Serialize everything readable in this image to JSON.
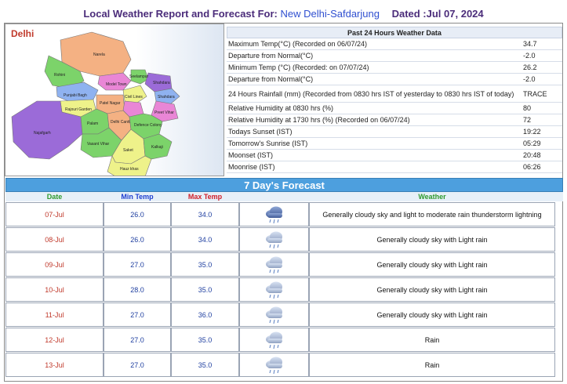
{
  "header": {
    "title_prefix": "Local Weather Report and Forecast For:",
    "location": "New Delhi-Safdarjung",
    "dated": "Dated :Jul 07, 2024"
  },
  "map": {
    "label": "Delhi",
    "districts": [
      "Narela",
      "Rohini",
      "Model Town",
      "Seelampur",
      "Shahdara",
      "Shahdara",
      "Punjabi Bagh",
      "Civil Lines",
      "Rajouri Garden",
      "Patel Nagar",
      "Preet Vihar",
      "Najafgarh",
      "Palam",
      "Vasant Vihar",
      "Delhi Cantt",
      "Defence Colony",
      "Saket",
      "Kalkaji",
      "Hauz khas"
    ],
    "colors": {
      "orange": "#f4b183",
      "green": "#7cd36a",
      "purple": "#9b6bd8",
      "yellow": "#eef28a",
      "pink": "#e986d6",
      "blue": "#8fb2f0"
    }
  },
  "past24": {
    "heading": "Past 24 Hours Weather Data",
    "rows": [
      {
        "label": "Maximum Temp(°C) (Recorded on 06/07/24)",
        "value": "34.7"
      },
      {
        "label": "Departure from Normal(°C)",
        "value": "-2.0"
      },
      {
        "label": "Minimum Temp (°C) (Recorded: on 07/07/24)",
        "value": "26.2"
      },
      {
        "label": "Departure from Normal(°C)",
        "value": "-2.0"
      },
      {
        "label": "24 Hours Rainfall (mm) (Recorded from 0830 hrs IST of yesterday to 0830 hrs IST of today)",
        "value": "TRACE"
      },
      {
        "label": "Relative Humidity at 0830 hrs (%)",
        "value": "80"
      },
      {
        "label": "Relative Humidity at 1730 hrs (%) (Recorded on 06/07/24)",
        "value": "72"
      },
      {
        "label": "Todays Sunset (IST)",
        "value": "19:22"
      },
      {
        "label": "Tomorrow's Sunrise (IST)",
        "value": "05:29"
      },
      {
        "label": "Moonset (IST)",
        "value": "20:48"
      },
      {
        "label": "Moonrise (IST)",
        "value": "06:26"
      }
    ]
  },
  "forecast": {
    "title": "7 Day's Forecast",
    "headers": {
      "date": "Date",
      "min": "Min Temp",
      "max": "Max Temp",
      "weather": "Weather"
    },
    "header_colors": {
      "date": "#2e9a2e",
      "min": "#1f3fd0",
      "max": "#d0202a",
      "weather": "#2e9a2e"
    },
    "rows": [
      {
        "date": "07-Jul",
        "min": "26.0",
        "max": "34.0",
        "icon": "thunderstorm-rain-icon",
        "weather": "Generally cloudy sky and light to moderate rain thunderstorm lightning"
      },
      {
        "date": "08-Jul",
        "min": "26.0",
        "max": "34.0",
        "icon": "light-rain-icon",
        "weather": "Generally cloudy sky with Light rain"
      },
      {
        "date": "09-Jul",
        "min": "27.0",
        "max": "35.0",
        "icon": "light-rain-icon",
        "weather": "Generally cloudy sky with Light rain"
      },
      {
        "date": "10-Jul",
        "min": "28.0",
        "max": "35.0",
        "icon": "light-rain-icon",
        "weather": "Generally cloudy sky with Light rain"
      },
      {
        "date": "11-Jul",
        "min": "27.0",
        "max": "36.0",
        "icon": "light-rain-icon",
        "weather": "Generally cloudy sky with Light rain"
      },
      {
        "date": "12-Jul",
        "min": "27.0",
        "max": "35.0",
        "icon": "light-rain-icon",
        "weather": "Rain"
      },
      {
        "date": "13-Jul",
        "min": "27.0",
        "max": "35.0",
        "icon": "light-rain-icon",
        "weather": "Rain"
      }
    ]
  }
}
